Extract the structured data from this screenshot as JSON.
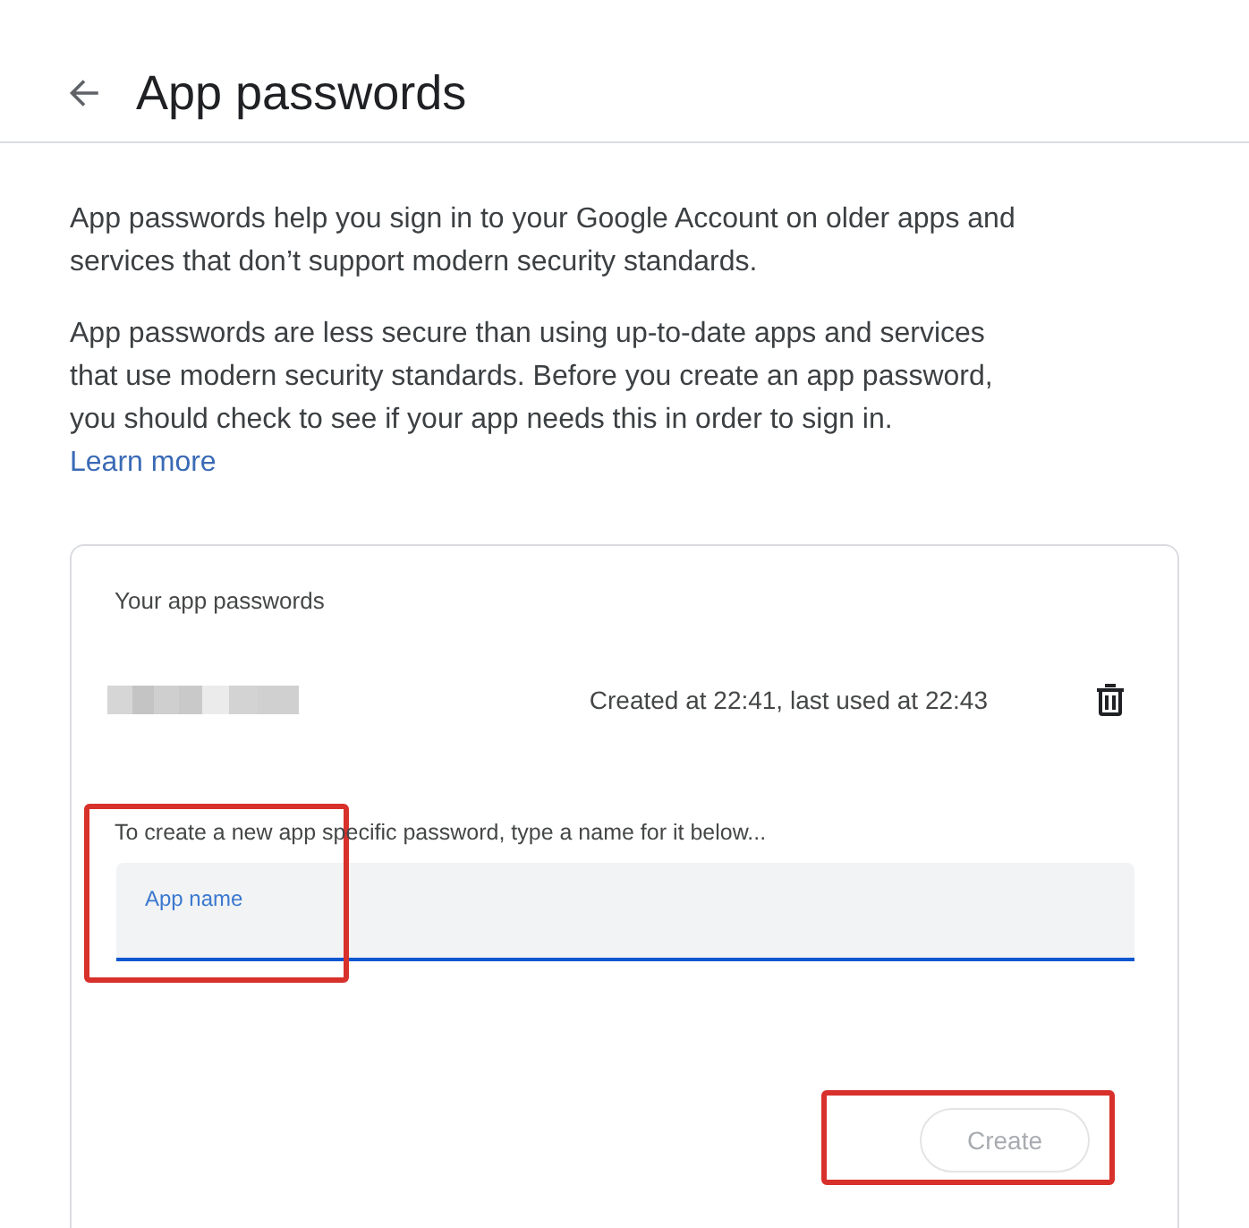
{
  "header": {
    "title": "App passwords"
  },
  "intro": {
    "paragraphs": [
      "App passwords help you sign in to your Google Account on older apps and services that don’t support modern security standards.",
      "App passwords are less secure than using up-to-date apps and services that use modern security standards. Before you create an app password, you should check to see if your app needs this in order to sign in."
    ],
    "link": "Learn more"
  },
  "passwords_card": {
    "heading": "Your app passwords",
    "passwords": [
      {
        "usage": "Created at 22:41, last used at 22:43"
      }
    ],
    "new_password": {
      "instruction": "To create a new app specific password, type a name for it below...",
      "field": {
        "label": "App name",
        "focused": true,
        "highlighted": true
      },
      "create_button": {
        "label": "Create",
        "disabled": true,
        "highlighted": true
      }
    }
  }
}
